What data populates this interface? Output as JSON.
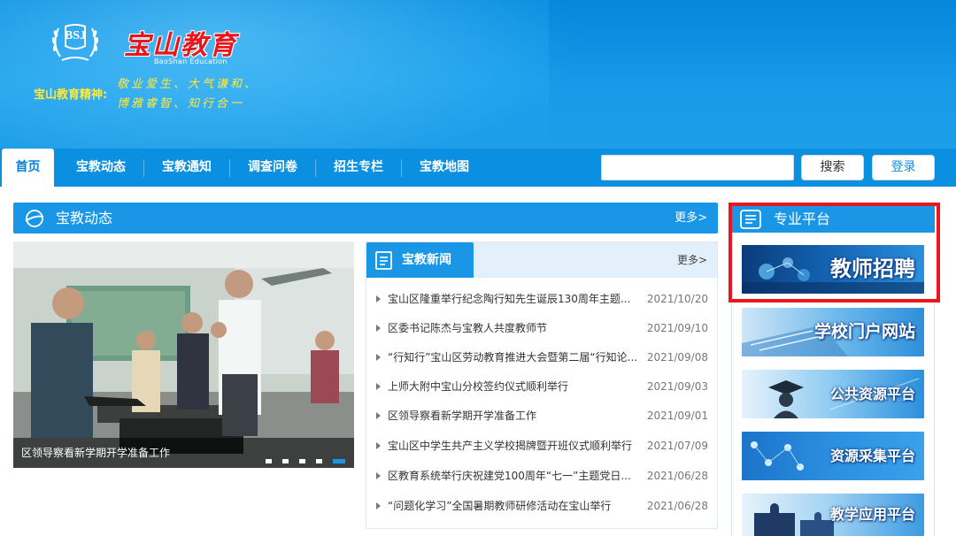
{
  "header": {
    "logo_text": "宝山教育",
    "logo_sub": "BaoShan Education",
    "emblem_text": "BSJ",
    "spirit_label": "宝山教育精神:",
    "spirit_line1": "敬业爱生、大气谦和、",
    "spirit_line2": "博雅睿智、知行合一"
  },
  "nav": {
    "items": [
      {
        "label": "首页",
        "active": true
      },
      {
        "label": "宝教动态"
      },
      {
        "label": "宝教通知"
      },
      {
        "label": "调查问卷"
      },
      {
        "label": "招生专栏"
      },
      {
        "label": "宝教地图"
      }
    ],
    "search_value": "",
    "search_button": "搜索",
    "login_button": "登录"
  },
  "section": {
    "title": "宝教动态",
    "more": "更多>"
  },
  "slideshow": {
    "caption": "区领导察看新学期开学准备工作",
    "dot_count": 5,
    "active_dot": 4
  },
  "news": {
    "tab": "宝教新闻",
    "more": "更多>",
    "items": [
      {
        "title": "宝山区隆重举行纪念陶行知先生诞辰130周年主题...",
        "date": "2021/10/20"
      },
      {
        "title": "区委书记陈杰与宝教人共度教师节",
        "date": "2021/09/10"
      },
      {
        "title": "“行知行”宝山区劳动教育推进大会暨第二届“行知论...",
        "date": "2021/09/08"
      },
      {
        "title": "上师大附中宝山分校签约仪式顺利举行",
        "date": "2021/09/03"
      },
      {
        "title": "区领导察看新学期开学准备工作",
        "date": "2021/09/01"
      },
      {
        "title": "宝山区中学生共产主义学校揭牌暨开班仪式顺利举行",
        "date": "2021/07/09"
      },
      {
        "title": "区教育系统举行庆祝建党100周年“七一”主题党日...",
        "date": "2021/06/28"
      },
      {
        "title": "“问题化学习”全国暑期教师研修活动在宝山举行",
        "date": "2021/06/28"
      }
    ]
  },
  "platform": {
    "title": "专业平台",
    "banners": [
      {
        "label": "教师招聘",
        "highlighted": true
      },
      {
        "label": "学校门户网站"
      },
      {
        "label": "公共资源平台"
      },
      {
        "label": "资源采集平台"
      },
      {
        "label": "教学应用平台"
      }
    ]
  },
  "colors": {
    "accent": "#1a96e6",
    "nav": "#0b8fe0",
    "highlight": "#e8171e",
    "logo_red": "#e8171e",
    "spirit_yellow": "#ffe93b"
  }
}
